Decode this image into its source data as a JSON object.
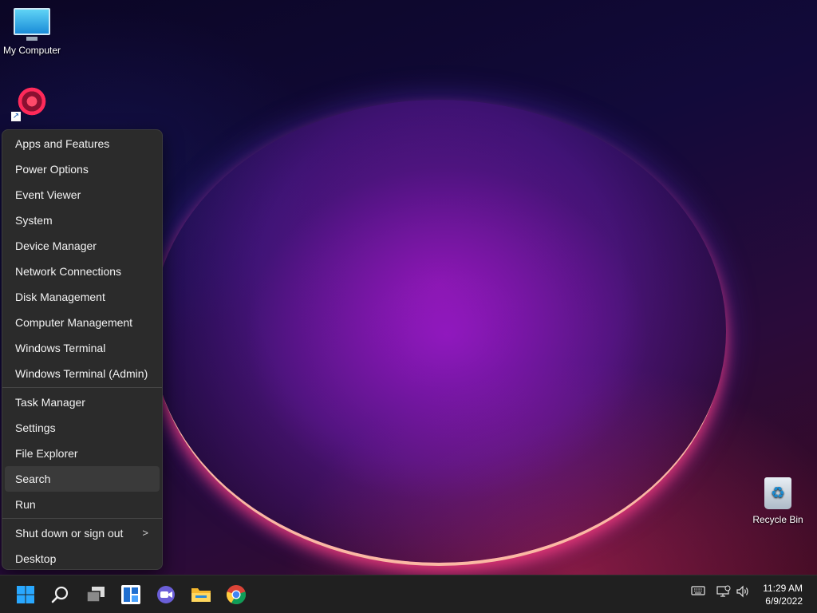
{
  "desktop": {
    "icons": {
      "my_computer": "My Computer",
      "shortcut": "",
      "recycle_bin": "Recycle Bin"
    }
  },
  "context_menu": {
    "groups": [
      [
        "Apps and Features",
        "Power Options",
        "Event Viewer",
        "System",
        "Device Manager",
        "Network Connections",
        "Disk Management",
        "Computer Management",
        "Windows Terminal",
        "Windows Terminal (Admin)"
      ],
      [
        "Task Manager",
        "Settings",
        "File Explorer",
        "Search",
        "Run"
      ],
      [
        "Shut down or sign out",
        "Desktop"
      ]
    ],
    "hovered_item": "Search",
    "submenu_indicator": ">"
  },
  "taskbar": {
    "apps": [
      "start-icon",
      "search-icon",
      "task-view-icon",
      "widgets-icon",
      "chat-icon",
      "file-explorer-icon",
      "chrome-icon"
    ],
    "tray_icons": [
      "keyboard-icon",
      "network-icon",
      "volume-icon"
    ],
    "clock": {
      "time": "11:29 AM",
      "date": "6/9/2022"
    }
  },
  "colors": {
    "menu_bg": "#2b2b2b",
    "taskbar_bg": "#202020",
    "accent_blue": "#29a8ff"
  }
}
